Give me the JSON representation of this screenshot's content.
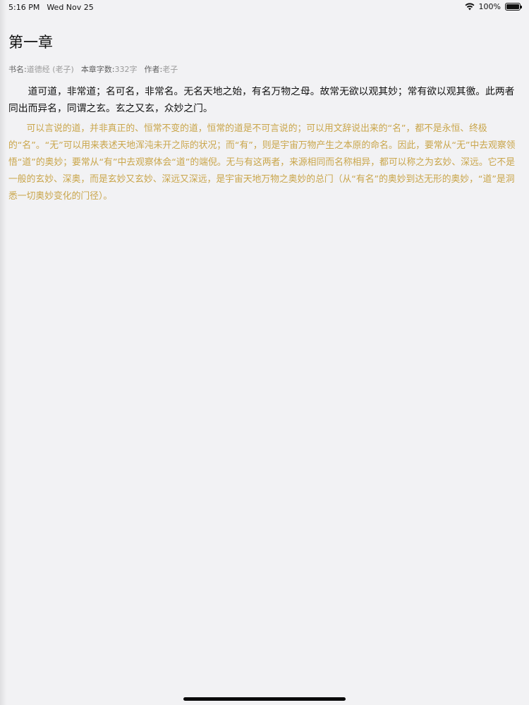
{
  "status_bar": {
    "time": "5:16 PM",
    "date": "Wed Nov 25",
    "battery": "100%",
    "icons": {
      "wifi": "wifi-icon",
      "battery": "battery-icon"
    }
  },
  "chapter": {
    "title": "第一章",
    "meta": {
      "book_label": "书名:",
      "book_value": "道德经 (老子)",
      "wordcount_label": "本章字数:",
      "wordcount_value": "332字",
      "author_label": "作者:",
      "author_value": "老子"
    },
    "original_text": "道可道，非常道；名可名，非常名。无名天地之始，有名万物之母。故常无欲以观其妙；常有欲以观其徼。此两者同出而异名，同谓之玄。玄之又玄，众妙之门。",
    "translation_text": "可以言说的道，并非真正的、恒常不变的道，恒常的道是不可言说的；可以用文辞说出来的“名”，都不是永恒、终极的“名”。“无”可以用来表述天地浑沌未开之际的状况；而“有”，则是宇宙万物产生之本原的命名。因此，要常从“无”中去观察领悟“道”的奥妙；要常从“有”中去观察体会“道”的端倪。无与有这两者，来源相同而名称相异，都可以称之为玄妙、深远。它不是一般的玄妙、深奥，而是玄妙又玄妙、深远又深远，是宇宙天地万物之奥妙的总门（从“有名”的奥妙到达无形的奥妙，“道”是洞悉一切奥妙变化的门径）。"
  },
  "colors": {
    "background": "#f2f2f4",
    "translation_text": "#c9a54a",
    "meta_text": "#9a9a9a"
  }
}
